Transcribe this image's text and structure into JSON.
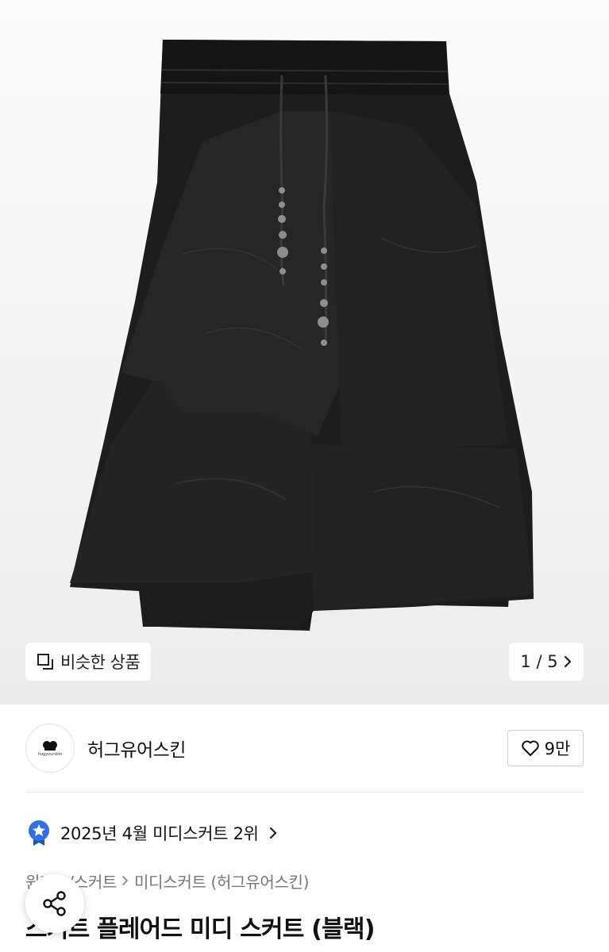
{
  "gallery": {
    "similar_label": "비슷한 상품",
    "counter_label": "1 / 5",
    "image_icon": "skirt-photo"
  },
  "brand": {
    "name": "허그유어스킨",
    "logo_text": "hugyourskin",
    "like_count": "9만"
  },
  "ranking": {
    "label": "2025년 4월 미디스커트 2위"
  },
  "breadcrumb": {
    "items": [
      "원피스/스커트",
      "미디스커트",
      "(허그유어스킨)"
    ]
  },
  "product": {
    "title": "스커트 플레어드 미디 스커트 (블랙)"
  },
  "colors": {
    "accent_blue": "#2f6fe8",
    "skirt_black": "#1e1e1e"
  },
  "icons": [
    "similar-products-icon",
    "chevron-right-icon",
    "heart-icon",
    "ranking-badge-icon",
    "share-icon"
  ]
}
